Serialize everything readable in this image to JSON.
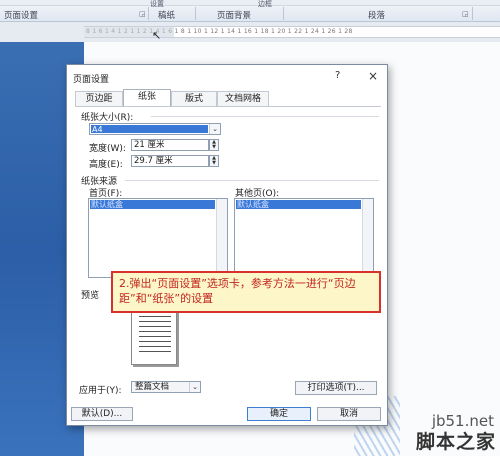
{
  "ribbon": {
    "top_items": [
      "设置",
      "边框"
    ],
    "groups": [
      "页面设置",
      "稿纸",
      "页面背景",
      "段落"
    ]
  },
  "ruler": {
    "text": "8 1 6 1 4 1 2 1  1 2 1 4 1 6 1 8 1 10 1 12 1 14 1 16 1 18 1 20 1 22 1 24 1 26 1 28"
  },
  "dialog": {
    "title": "页面设置",
    "help": "?",
    "close": "×",
    "tabs": [
      "页边距",
      "纸张",
      "版式",
      "文档网格"
    ],
    "active_tab": "纸张",
    "paper_size_label": "纸张大小(R):",
    "paper_size_value": "A4",
    "width_label": "宽度(W):",
    "width_value": "21 厘米",
    "height_label": "高度(E):",
    "height_value": "29.7 厘米",
    "paper_source_label": "纸张来源",
    "first_page_label": "首页(F):",
    "first_page_value": "默认纸盒",
    "other_pages_label": "其他页(O):",
    "other_pages_value": "默认纸盒",
    "preview_label": "预览",
    "apply_to_label": "应用于(Y):",
    "apply_to_value": "整篇文档",
    "print_options_button": "打印选项(T)...",
    "default_button": "默认(D)...",
    "ok_button": "确定",
    "cancel_button": "取消"
  },
  "callout": {
    "text": "2.弹出“页面设置”选项卡，参考方法一进行“页边距”和“纸张”的设置"
  },
  "watermark": {
    "url": "jb51.net",
    "name": "脚本之家"
  },
  "colors": {
    "selection": "#3a78d8",
    "callout_border": "#d7312a",
    "callout_bg": "#fdf6c8",
    "callout_text": "#c1261f"
  }
}
